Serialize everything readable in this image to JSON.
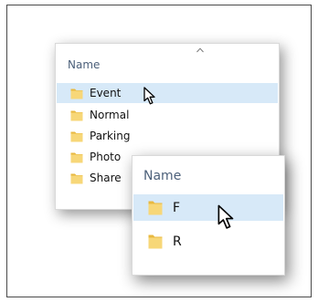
{
  "explorer": {
    "header": {
      "name_label": "Name"
    },
    "sort_indicator_icon": "chevron-up-icon",
    "items": [
      {
        "label": "Event",
        "selected": true
      },
      {
        "label": "Normal",
        "selected": false
      },
      {
        "label": "Parking",
        "selected": false
      },
      {
        "label": "Photo",
        "selected": false
      },
      {
        "label": "Share",
        "selected": false
      }
    ]
  },
  "zoom": {
    "header": {
      "name_label": "Name"
    },
    "items": [
      {
        "label": "F",
        "selected": true
      },
      {
        "label": "R",
        "selected": false
      }
    ]
  },
  "colors": {
    "header_text": "#4c607a",
    "selection": "#d7e9f8",
    "folder_body": "#f7d778",
    "folder_back": "#e8b941",
    "frame_border": "#4a4a4a"
  }
}
